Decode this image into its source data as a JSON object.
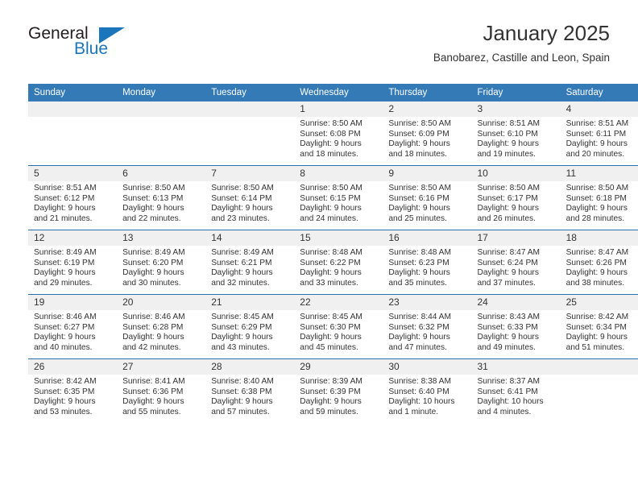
{
  "brand": {
    "name_part1": "General",
    "name_part2": "Blue",
    "triangle_icon": "blue-triangle-icon",
    "accent_color": "#1b75bb"
  },
  "header": {
    "title": "January 2025",
    "subtitle": "Banobarez, Castille and Leon, Spain"
  },
  "calendar": {
    "header_color": "#337ab7",
    "daynum_band_color": "#f0f0f0",
    "weekday_headers": [
      "Sunday",
      "Monday",
      "Tuesday",
      "Wednesday",
      "Thursday",
      "Friday",
      "Saturday"
    ],
    "weeks": [
      [
        {
          "day": "",
          "lines": []
        },
        {
          "day": "",
          "lines": []
        },
        {
          "day": "",
          "lines": []
        },
        {
          "day": "1",
          "lines": [
            "Sunrise: 8:50 AM",
            "Sunset: 6:08 PM",
            "Daylight: 9 hours",
            "and 18 minutes."
          ]
        },
        {
          "day": "2",
          "lines": [
            "Sunrise: 8:50 AM",
            "Sunset: 6:09 PM",
            "Daylight: 9 hours",
            "and 18 minutes."
          ]
        },
        {
          "day": "3",
          "lines": [
            "Sunrise: 8:51 AM",
            "Sunset: 6:10 PM",
            "Daylight: 9 hours",
            "and 19 minutes."
          ]
        },
        {
          "day": "4",
          "lines": [
            "Sunrise: 8:51 AM",
            "Sunset: 6:11 PM",
            "Daylight: 9 hours",
            "and 20 minutes."
          ]
        }
      ],
      [
        {
          "day": "5",
          "lines": [
            "Sunrise: 8:51 AM",
            "Sunset: 6:12 PM",
            "Daylight: 9 hours",
            "and 21 minutes."
          ]
        },
        {
          "day": "6",
          "lines": [
            "Sunrise: 8:50 AM",
            "Sunset: 6:13 PM",
            "Daylight: 9 hours",
            "and 22 minutes."
          ]
        },
        {
          "day": "7",
          "lines": [
            "Sunrise: 8:50 AM",
            "Sunset: 6:14 PM",
            "Daylight: 9 hours",
            "and 23 minutes."
          ]
        },
        {
          "day": "8",
          "lines": [
            "Sunrise: 8:50 AM",
            "Sunset: 6:15 PM",
            "Daylight: 9 hours",
            "and 24 minutes."
          ]
        },
        {
          "day": "9",
          "lines": [
            "Sunrise: 8:50 AM",
            "Sunset: 6:16 PM",
            "Daylight: 9 hours",
            "and 25 minutes."
          ]
        },
        {
          "day": "10",
          "lines": [
            "Sunrise: 8:50 AM",
            "Sunset: 6:17 PM",
            "Daylight: 9 hours",
            "and 26 minutes."
          ]
        },
        {
          "day": "11",
          "lines": [
            "Sunrise: 8:50 AM",
            "Sunset: 6:18 PM",
            "Daylight: 9 hours",
            "and 28 minutes."
          ]
        }
      ],
      [
        {
          "day": "12",
          "lines": [
            "Sunrise: 8:49 AM",
            "Sunset: 6:19 PM",
            "Daylight: 9 hours",
            "and 29 minutes."
          ]
        },
        {
          "day": "13",
          "lines": [
            "Sunrise: 8:49 AM",
            "Sunset: 6:20 PM",
            "Daylight: 9 hours",
            "and 30 minutes."
          ]
        },
        {
          "day": "14",
          "lines": [
            "Sunrise: 8:49 AM",
            "Sunset: 6:21 PM",
            "Daylight: 9 hours",
            "and 32 minutes."
          ]
        },
        {
          "day": "15",
          "lines": [
            "Sunrise: 8:48 AM",
            "Sunset: 6:22 PM",
            "Daylight: 9 hours",
            "and 33 minutes."
          ]
        },
        {
          "day": "16",
          "lines": [
            "Sunrise: 8:48 AM",
            "Sunset: 6:23 PM",
            "Daylight: 9 hours",
            "and 35 minutes."
          ]
        },
        {
          "day": "17",
          "lines": [
            "Sunrise: 8:47 AM",
            "Sunset: 6:24 PM",
            "Daylight: 9 hours",
            "and 37 minutes."
          ]
        },
        {
          "day": "18",
          "lines": [
            "Sunrise: 8:47 AM",
            "Sunset: 6:26 PM",
            "Daylight: 9 hours",
            "and 38 minutes."
          ]
        }
      ],
      [
        {
          "day": "19",
          "lines": [
            "Sunrise: 8:46 AM",
            "Sunset: 6:27 PM",
            "Daylight: 9 hours",
            "and 40 minutes."
          ]
        },
        {
          "day": "20",
          "lines": [
            "Sunrise: 8:46 AM",
            "Sunset: 6:28 PM",
            "Daylight: 9 hours",
            "and 42 minutes."
          ]
        },
        {
          "day": "21",
          "lines": [
            "Sunrise: 8:45 AM",
            "Sunset: 6:29 PM",
            "Daylight: 9 hours",
            "and 43 minutes."
          ]
        },
        {
          "day": "22",
          "lines": [
            "Sunrise: 8:45 AM",
            "Sunset: 6:30 PM",
            "Daylight: 9 hours",
            "and 45 minutes."
          ]
        },
        {
          "day": "23",
          "lines": [
            "Sunrise: 8:44 AM",
            "Sunset: 6:32 PM",
            "Daylight: 9 hours",
            "and 47 minutes."
          ]
        },
        {
          "day": "24",
          "lines": [
            "Sunrise: 8:43 AM",
            "Sunset: 6:33 PM",
            "Daylight: 9 hours",
            "and 49 minutes."
          ]
        },
        {
          "day": "25",
          "lines": [
            "Sunrise: 8:42 AM",
            "Sunset: 6:34 PM",
            "Daylight: 9 hours",
            "and 51 minutes."
          ]
        }
      ],
      [
        {
          "day": "26",
          "lines": [
            "Sunrise: 8:42 AM",
            "Sunset: 6:35 PM",
            "Daylight: 9 hours",
            "and 53 minutes."
          ]
        },
        {
          "day": "27",
          "lines": [
            "Sunrise: 8:41 AM",
            "Sunset: 6:36 PM",
            "Daylight: 9 hours",
            "and 55 minutes."
          ]
        },
        {
          "day": "28",
          "lines": [
            "Sunrise: 8:40 AM",
            "Sunset: 6:38 PM",
            "Daylight: 9 hours",
            "and 57 minutes."
          ]
        },
        {
          "day": "29",
          "lines": [
            "Sunrise: 8:39 AM",
            "Sunset: 6:39 PM",
            "Daylight: 9 hours",
            "and 59 minutes."
          ]
        },
        {
          "day": "30",
          "lines": [
            "Sunrise: 8:38 AM",
            "Sunset: 6:40 PM",
            "Daylight: 10 hours",
            "and 1 minute."
          ]
        },
        {
          "day": "31",
          "lines": [
            "Sunrise: 8:37 AM",
            "Sunset: 6:41 PM",
            "Daylight: 10 hours",
            "and 4 minutes."
          ]
        },
        {
          "day": "",
          "lines": []
        }
      ]
    ]
  }
}
